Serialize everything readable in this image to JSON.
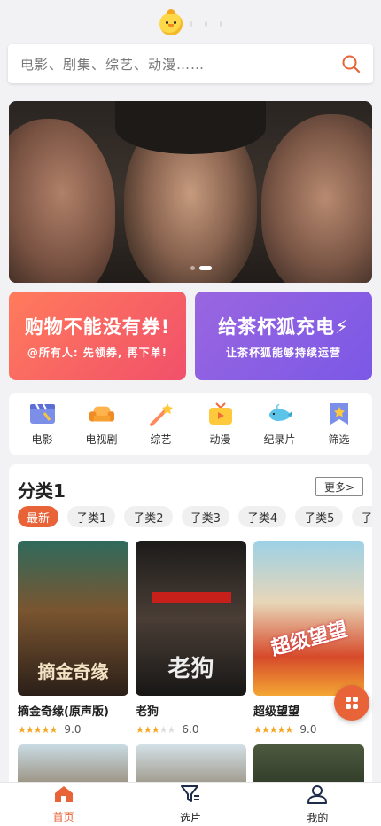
{
  "search": {
    "placeholder": "电影、剧集、综艺、动漫……"
  },
  "promos": [
    {
      "title": "购物不能没有券!",
      "subtitle": "@所有人: 先领券, 再下单!"
    },
    {
      "title": "给茶杯狐充电",
      "subtitle": "让茶杯狐能够持续运营"
    }
  ],
  "categories": [
    {
      "label": "电影",
      "icon": "movie-clapper-icon"
    },
    {
      "label": "电视剧",
      "icon": "tv-sofa-icon"
    },
    {
      "label": "综艺",
      "icon": "magic-wand-icon"
    },
    {
      "label": "动漫",
      "icon": "anime-tv-icon"
    },
    {
      "label": "纪录片",
      "icon": "whale-icon"
    },
    {
      "label": "筛选",
      "icon": "bookmark-star-icon"
    }
  ],
  "section": {
    "title": "分类1",
    "more": "更多>",
    "tags": [
      "最新",
      "子类1",
      "子类2",
      "子类3",
      "子类4",
      "子类5",
      "子"
    ],
    "movies": [
      {
        "title": "摘金奇缘(原声版)",
        "poster_text": "摘金奇缘",
        "score": "9.0",
        "stars": 5
      },
      {
        "title": "老狗",
        "poster_text": "老狗",
        "score": "6.0",
        "stars": 3
      },
      {
        "title": "超级望望",
        "poster_text": "超级望望",
        "score": "9.0",
        "stars": 5
      }
    ]
  },
  "nav": [
    {
      "label": "首页",
      "icon": "home-icon",
      "active": true
    },
    {
      "label": "选片",
      "icon": "filter-icon",
      "active": false
    },
    {
      "label": "我的",
      "icon": "user-icon",
      "active": false
    }
  ],
  "colors": {
    "accent": "#e96339",
    "star": "#f5a623"
  }
}
